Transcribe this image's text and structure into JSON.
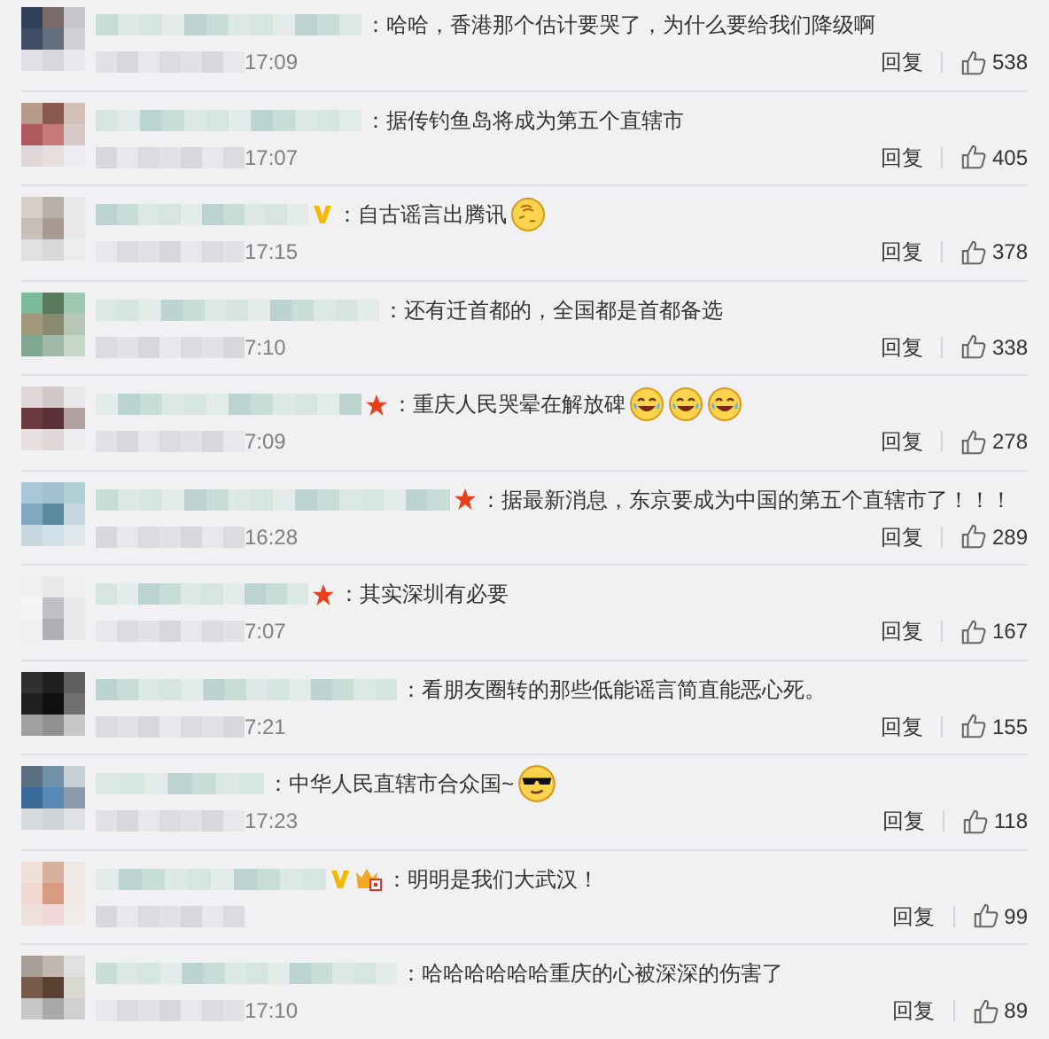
{
  "comments": [
    {
      "text": "：哈哈，香港那个估计要哭了，为什么要给我们降级啊",
      "time": "17:09",
      "reply": "回复",
      "likes": "538"
    },
    {
      "text": "：据传钓鱼岛将成为第五个直辖市",
      "time": "17:07",
      "reply": "回复",
      "likes": "405"
    },
    {
      "badges": [
        {
          "kind": "vip"
        }
      ],
      "text": "：自古谣言出腾讯",
      "emojis": [
        {
          "kind": "blush"
        }
      ],
      "time": "17:15",
      "reply": "回复",
      "likes": "378"
    },
    {
      "text": "：还有迁首都的，全国都是首都备选",
      "time": "7:10",
      "reply": "回复",
      "likes": "338"
    },
    {
      "badges": [
        {
          "kind": "star"
        }
      ],
      "text": "：重庆人民哭晕在解放碑",
      "emojis": [
        {
          "kind": "laugh-cry"
        },
        {
          "kind": "laugh-cry"
        },
        {
          "kind": "laugh-cry"
        }
      ],
      "time": "7:09",
      "reply": "回复",
      "likes": "278"
    },
    {
      "badges": [
        {
          "kind": "star"
        }
      ],
      "text": "：据最新消息，东京要成为中国的第五个直辖市了！！！",
      "time": "16:28",
      "reply": "回复",
      "likes": "289"
    },
    {
      "badges": [
        {
          "kind": "star"
        }
      ],
      "text": "：其实深圳有必要",
      "time": "7:07",
      "reply": "回复",
      "likes": "167"
    },
    {
      "text": "：看朋友圈转的那些低能谣言简直能恶心死。",
      "time": "7:21",
      "reply": "回复",
      "likes": "155"
    },
    {
      "text": "：中华人民直辖市合众国~",
      "emojis": [
        {
          "kind": "cool"
        }
      ],
      "time": "17:23",
      "reply": "回复",
      "likes": "118"
    },
    {
      "badges": [
        {
          "kind": "vip"
        },
        {
          "kind": "crown"
        }
      ],
      "text": "：明明是我们大武汉！",
      "reply": "回复",
      "likes": "99"
    },
    {
      "text": "：哈哈哈哈哈哈重庆的心被深深的伤害了",
      "time": "17:10",
      "reply": "回复",
      "likes": "89"
    }
  ]
}
